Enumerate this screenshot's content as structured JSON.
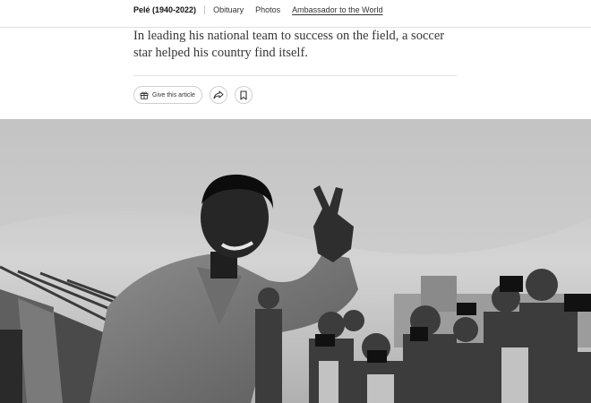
{
  "nav": {
    "title": "Pelé (1940-2022)",
    "links": [
      "Obituary",
      "Photos",
      "Ambassador to the World"
    ],
    "active_link": "Ambassador to the World"
  },
  "article": {
    "summary": "In leading his national team to success on the field, a soccer star helped his country find itself."
  },
  "tools": {
    "gift_label": "Give this article",
    "gift_icon": "gift-icon",
    "share_icon": "share-icon",
    "save_icon": "bookmark-icon"
  },
  "photo": {
    "description_icon": "black-and-white-photo"
  }
}
